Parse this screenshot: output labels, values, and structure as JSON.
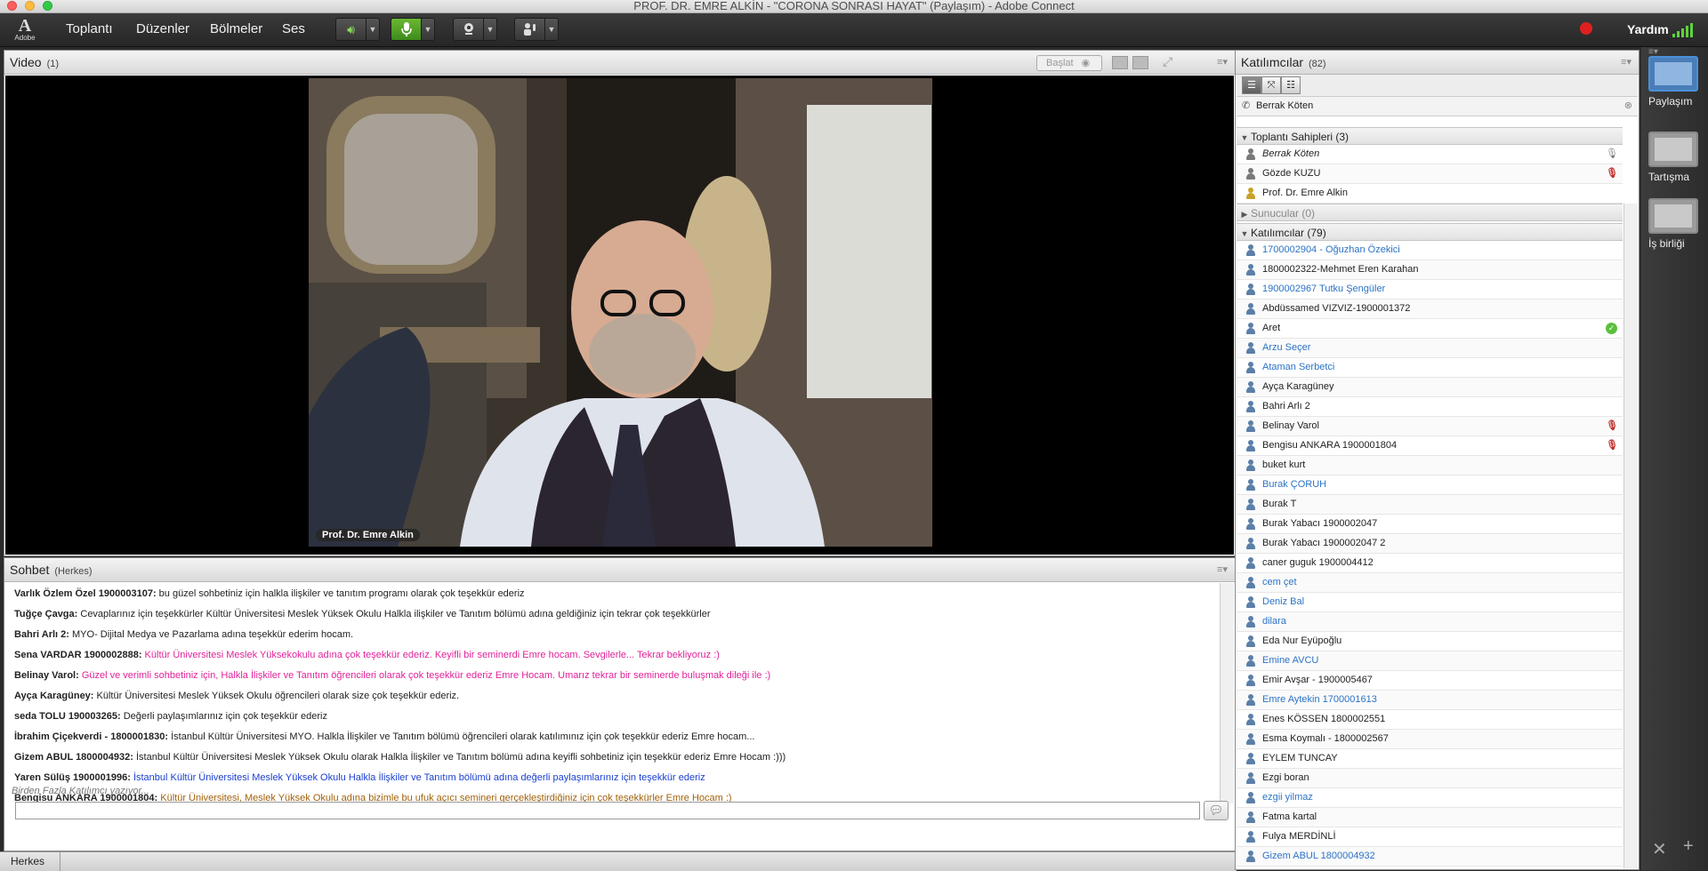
{
  "window": {
    "title": "PROF. DR. EMRE ALKİN - \"CORONA SONRASI HAYAT\" (Paylaşım) - Adobe Connect"
  },
  "menubar": {
    "logo_text": "Adobe",
    "items": [
      "Toplantı",
      "Düzenler",
      "Bölmeler",
      "Ses"
    ],
    "help": "Yardım"
  },
  "video_pod": {
    "title": "Video",
    "count": "(1)",
    "start_label": "Başlat",
    "speaker_name": "Prof. Dr. Emre Alkin"
  },
  "chat_pod": {
    "title": "Sohbet",
    "scope": "(Herkes)",
    "messages": [
      {
        "sender": "Varlık  Özlem Özel  1900003107:",
        "text": "bu güzel sohbetiniz için halkla ilişkiler ve tanıtım programı olarak çok teşekkür ederiz",
        "style": "default"
      },
      {
        "sender": "Tuğçe Çavga:",
        "text": "Cevaplarınız için teşekkürler Kültür Üniversitesi Meslek Yüksek Okulu Halkla ilişkiler ve Tanıtım bölümü adına geldiğiniz için tekrar çok teşekkürler",
        "style": "default"
      },
      {
        "sender": "Bahri Arlı 2:",
        "text": "MYO- Dijital Medya ve Pazarlama adına teşekkür ederim hocam.",
        "style": "default"
      },
      {
        "sender": "Sena VARDAR 1900002888:",
        "text": "Kültür Üniversitesi Meslek Yüksekokulu adına çok teşekkür ederiz. Keyifli bir seminerdi Emre hocam. Sevgilerle... Tekrar bekliyoruz :)",
        "style": "pink"
      },
      {
        "sender": "Belinay Varol:",
        "text": "Güzel ve verimli sohbetiniz için, Halkla İlişkiler ve Tanıtım öğrencileri olarak çok teşekkür ederiz Emre Hocam. Umarız tekrar bir seminerde buluşmak dileği ile :)",
        "style": "pink"
      },
      {
        "sender": "Ayça Karagüney:",
        "text": "Kültür Üniversitesi Meslek Yüksek Okulu öğrencileri olarak size çok teşekkür ederiz.",
        "style": "default"
      },
      {
        "sender": "seda TOLU 190003265:",
        "text": "Değerli paylaşımlarınız için çok teşekkür ederiz",
        "style": "default"
      },
      {
        "sender": "İbrahim Çiçekverdi - 1800001830:",
        "text": "İstanbul Kültür Üniversitesi MYO. Halkla İlişkiler ve Tanıtım bölümü öğrencileri olarak katılımınız için çok teşekkür ederiz Emre hocam...",
        "style": "default"
      },
      {
        "sender": "Gizem ABUL 1800004932:",
        "text": "İstanbul Kültür Üniversitesi Meslek Yüksek Okulu olarak Halkla İlişkiler ve Tanıtım bölümü adına keyifli sohbetiniz için teşekkür ederiz Emre Hocam :)))",
        "style": "default"
      },
      {
        "sender": "Yaren Sülüş 1900001996:",
        "text": "İstanbul Kültür Üniversitesi Meslek Yüksek Okulu Halkla İlişkiler ve Tanıtım bölümü adına değerli paylaşımlarınız için teşekkür ederiz",
        "style": "blue"
      },
      {
        "sender": "Bengisu ANKARA 1900001804:",
        "text": "Kültür Üniversitesi, Meslek Yüksek Okulu adına bizimle bu ufuk açıcı semineri gerçekleştirdiğiniz için çok teşekkürler Emre Hocam :)",
        "style": "brown"
      }
    ],
    "typing": "Birden Fazla Katılımcı yazıyor...",
    "input_placeholder": "",
    "audience_tab": "Herkes"
  },
  "attendees_pod": {
    "title": "Katılımcılar",
    "count": "(82)",
    "current_user": "Berrak Köten",
    "groups": {
      "hosts": "Toplantı Sahipleri (3)",
      "presenters": "Sunucular (0)",
      "participants": "Katılımcılar (79)"
    },
    "hosts": [
      {
        "name": "Berrak Köten",
        "blue": false,
        "italic": true,
        "status": "mic-grey",
        "icon": "host"
      },
      {
        "name": "Gözde KUZU",
        "blue": false,
        "italic": false,
        "status": "mic",
        "icon": "host"
      },
      {
        "name": "Prof. Dr. Emre Alkin",
        "blue": false,
        "italic": false,
        "status": "",
        "icon": "gold"
      }
    ],
    "participants": [
      {
        "name": "1700002904 - Oğuzhan Özekici",
        "blue": true,
        "status": ""
      },
      {
        "name": "1800002322-Mehmet Eren Karahan",
        "blue": false,
        "status": ""
      },
      {
        "name": "1900002967 Tutku Şengüler",
        "blue": true,
        "status": ""
      },
      {
        "name": "Abdüssamed VIZVIZ-1900001372",
        "blue": false,
        "status": ""
      },
      {
        "name": "Aret",
        "blue": false,
        "status": "check"
      },
      {
        "name": "Arzu Seçer",
        "blue": true,
        "status": ""
      },
      {
        "name": "Ataman Serbetci",
        "blue": true,
        "status": ""
      },
      {
        "name": "Ayça Karagüney",
        "blue": false,
        "status": ""
      },
      {
        "name": "Bahri Arlı 2",
        "blue": false,
        "status": ""
      },
      {
        "name": "Belinay Varol",
        "blue": false,
        "status": "mic"
      },
      {
        "name": "Bengisu ANKARA 1900001804",
        "blue": false,
        "status": "mic"
      },
      {
        "name": "buket kurt",
        "blue": false,
        "status": ""
      },
      {
        "name": "Burak ÇORUH",
        "blue": true,
        "status": ""
      },
      {
        "name": "Burak T",
        "blue": false,
        "status": ""
      },
      {
        "name": "Burak Yabacı 1900002047",
        "blue": false,
        "status": ""
      },
      {
        "name": "Burak Yabacı 1900002047 2",
        "blue": false,
        "status": ""
      },
      {
        "name": "caner guguk 1900004412",
        "blue": false,
        "status": ""
      },
      {
        "name": "cem çet",
        "blue": true,
        "status": ""
      },
      {
        "name": "Deniz Bal",
        "blue": true,
        "status": ""
      },
      {
        "name": "dilara",
        "blue": true,
        "status": ""
      },
      {
        "name": "Eda Nur Eyüpoğlu",
        "blue": false,
        "status": ""
      },
      {
        "name": "Emine AVCU",
        "blue": true,
        "status": ""
      },
      {
        "name": "Emir Avşar - 1900005467",
        "blue": false,
        "status": ""
      },
      {
        "name": "Emre Aytekin 1700001613",
        "blue": true,
        "status": ""
      },
      {
        "name": "Enes KÖSSEN 1800002551",
        "blue": false,
        "status": ""
      },
      {
        "name": "Esma Koymalı - 1800002567",
        "blue": false,
        "status": ""
      },
      {
        "name": "EYLEM TUNCAY",
        "blue": false,
        "status": ""
      },
      {
        "name": "Ezgi boran",
        "blue": false,
        "status": ""
      },
      {
        "name": "ezgii yilmaz",
        "blue": true,
        "status": ""
      },
      {
        "name": "Fatma kartal",
        "blue": false,
        "status": ""
      },
      {
        "name": "Fulya MERDİNLİ",
        "blue": false,
        "status": ""
      },
      {
        "name": "Gizem ABUL 1800004932",
        "blue": true,
        "status": ""
      }
    ]
  },
  "layouts": {
    "items": [
      {
        "label": "Paylaşım",
        "active": true
      },
      {
        "label": "Tartışma",
        "active": false
      },
      {
        "label": "İş birliği",
        "active": false
      }
    ]
  },
  "colors": {
    "chat_pink": "#e0229a",
    "chat_blue": "#1a3fd1",
    "chat_brown": "#a1620b",
    "attendee_blue": "#2b73c6",
    "mic_active": "#6bb832",
    "record": "#e02020"
  }
}
